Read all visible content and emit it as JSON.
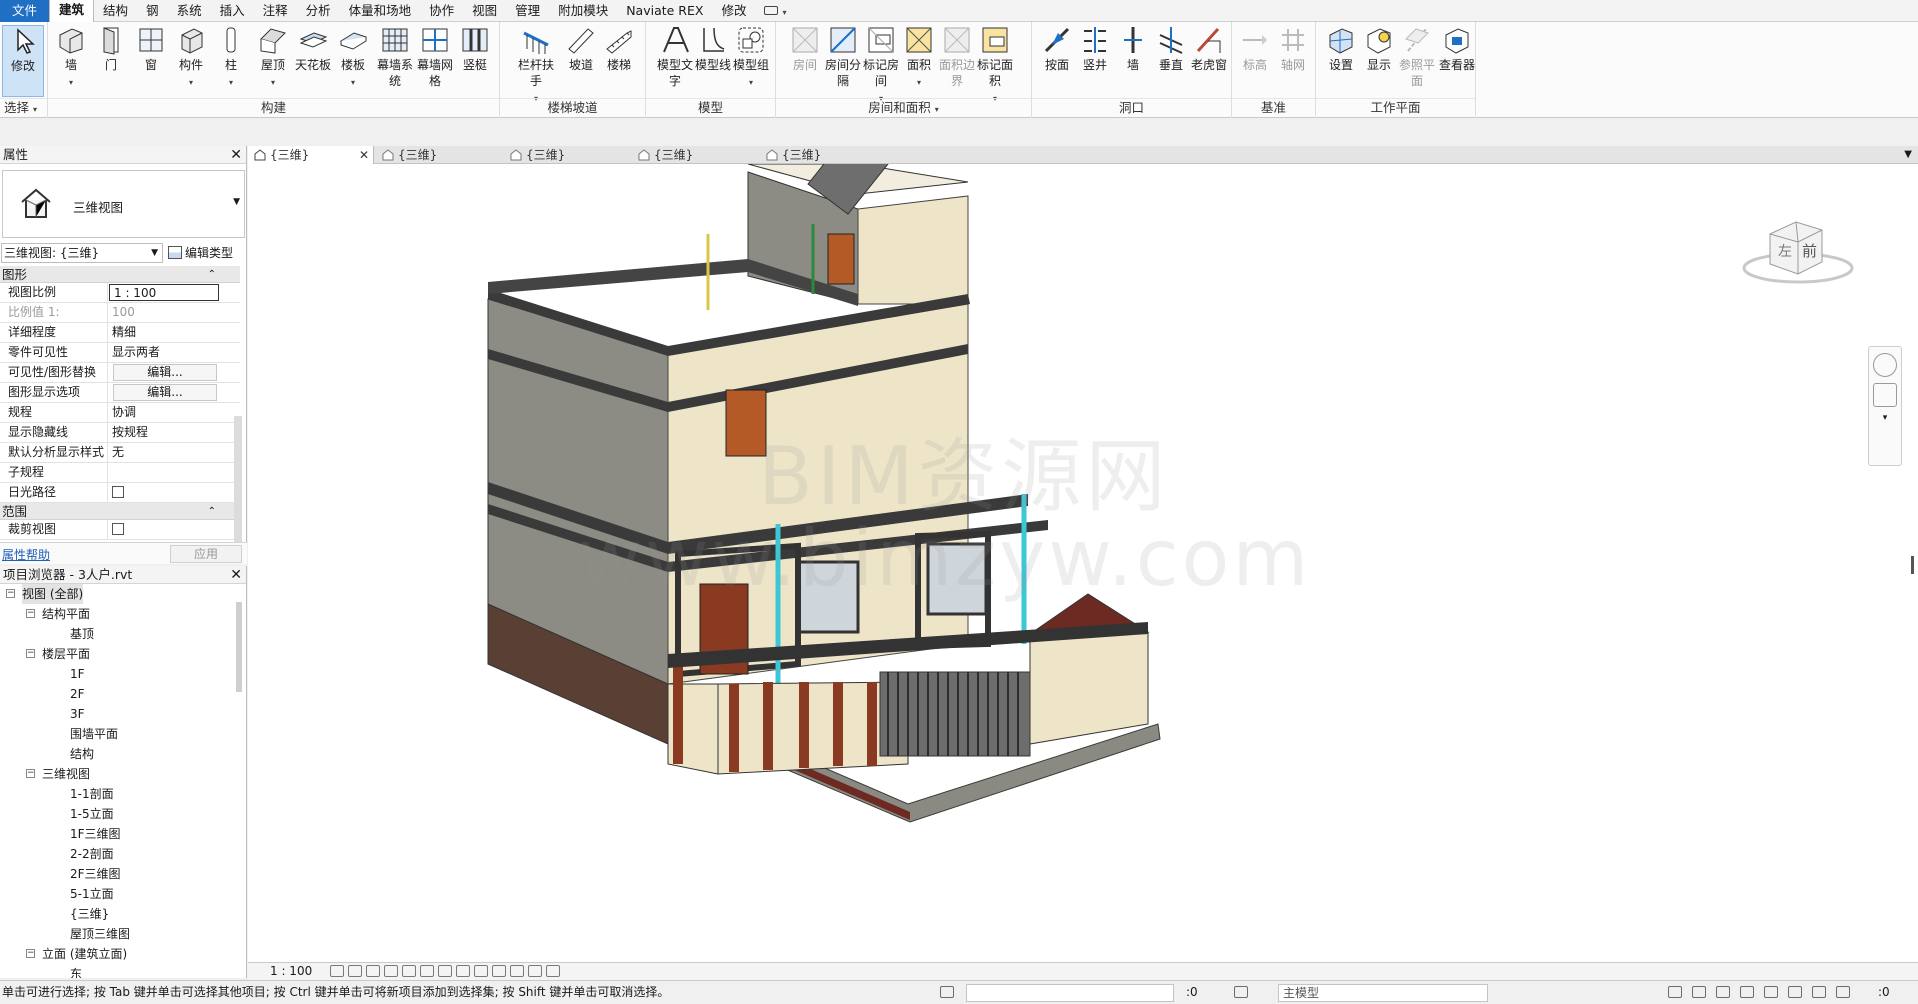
{
  "menu": {
    "tabs": [
      "文件",
      "建筑",
      "结构",
      "钢",
      "系统",
      "插入",
      "注释",
      "分析",
      "体量和场地",
      "协作",
      "视图",
      "管理",
      "附加模块",
      "Naviate REX",
      "修改"
    ],
    "active_tab": "建筑"
  },
  "ribbon": {
    "select": {
      "modify_label": "修改",
      "select_label": "选择"
    },
    "build": {
      "label": "构建",
      "buttons": [
        "墙",
        "门",
        "窗",
        "构件",
        "柱",
        "屋顶",
        "天花板",
        "楼板",
        "幕墙系统",
        "幕墙网格",
        "竖梃"
      ]
    },
    "stairs": {
      "label": "楼梯坡道",
      "buttons": [
        "栏杆扶手",
        "坡道",
        "楼梯"
      ]
    },
    "model": {
      "label": "模型",
      "buttons": [
        "模型文字",
        "模型线",
        "模型组"
      ]
    },
    "room": {
      "label": "房间和面积",
      "buttons": [
        "房间",
        "房间分隔",
        "标记房间",
        "面积",
        "面积边界",
        "标记面积"
      ]
    },
    "opening": {
      "label": "洞口",
      "buttons": [
        "按面",
        "竖井",
        "墙",
        "垂直",
        "老虎窗"
      ]
    },
    "datum": {
      "label": "基准",
      "buttons": [
        "标高",
        "轴网"
      ]
    },
    "workplane": {
      "label": "工作平面",
      "buttons": [
        "设置",
        "显示",
        "参照平面",
        "查看器"
      ]
    }
  },
  "properties": {
    "title": "属性",
    "type_name": "三维视图",
    "instance": "三维视图: {三维}",
    "edit_type": "编辑类型",
    "sections": [
      {
        "name": "图形",
        "rows": [
          {
            "k": "视图比例",
            "v": "1 : 100"
          },
          {
            "k": "比例值 1:",
            "v": "100"
          },
          {
            "k": "详细程度",
            "v": "精细"
          },
          {
            "k": "零件可见性",
            "v": "显示两者"
          },
          {
            "k": "可见性/图形替换",
            "v": "编辑..."
          },
          {
            "k": "图形显示选项",
            "v": "编辑..."
          },
          {
            "k": "规程",
            "v": "协调"
          },
          {
            "k": "显示隐藏线",
            "v": "按规程"
          },
          {
            "k": "默认分析显示样式",
            "v": "无"
          },
          {
            "k": "子规程",
            "v": ""
          },
          {
            "k": "日光路径",
            "v": ""
          }
        ]
      },
      {
        "name": "范围",
        "rows": [
          {
            "k": "裁剪视图",
            "v": ""
          }
        ]
      }
    ],
    "help": "属性帮助",
    "apply": "应用"
  },
  "browser": {
    "title": "项目浏览器 - 3人户.rvt",
    "root": "视图 (全部)",
    "groups": [
      {
        "name": "结构平面",
        "items": [
          "基顶"
        ]
      },
      {
        "name": "楼层平面",
        "items": [
          "1F",
          "2F",
          "3F",
          "围墙平面",
          "结构"
        ]
      },
      {
        "name": "三维视图",
        "items": [
          "1-1剖面",
          "1-5立面",
          "1F三维图",
          "2-2剖面",
          "2F三维图",
          "5-1立面",
          "{三维}",
          "屋顶三维图"
        ]
      },
      {
        "name": "立面 (建筑立面)",
        "items": [
          "东"
        ]
      }
    ]
  },
  "view_tabs": [
    "{三维}",
    "{三维}",
    "{三维}",
    "{三维}",
    "{三维}"
  ],
  "viewport": {
    "watermark_line1": "BIM资源网",
    "watermark_line2": "www.bimzyw.com",
    "viewcube_left": "左",
    "viewcube_front": "前"
  },
  "view_control": {
    "scale": "1 : 100"
  },
  "status": {
    "text": "单击可进行选择; 按 Tab 键并单击可选择其他项目; 按 Ctrl 键并单击可将新项目添加到选择集; 按 Shift 键并单击可取消选择。",
    "selected_count": ":0",
    "model": "主模型",
    "filter_count": ":0"
  },
  "colors": {
    "file_tab": "#1f6fc4",
    "wall_cream": "#efe7cf",
    "trim_dark": "#3a3a3a",
    "brick": "#7a3a2a",
    "pipe": "#3fc6d6"
  }
}
